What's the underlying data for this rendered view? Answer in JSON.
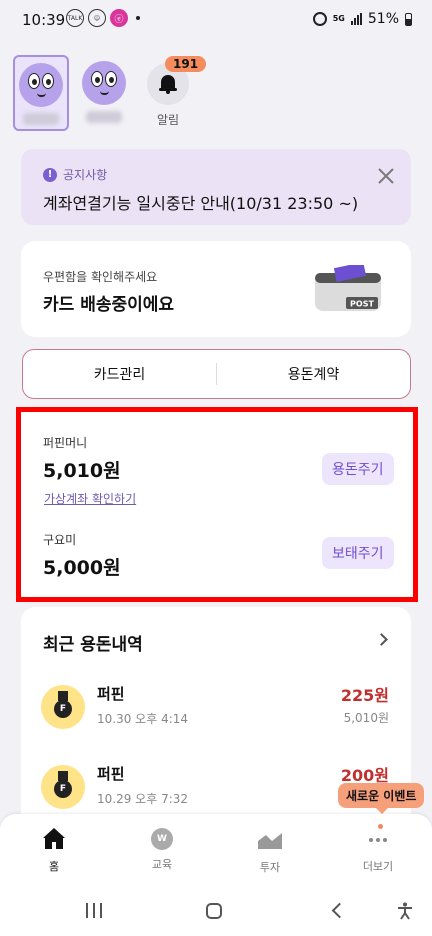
{
  "status_bar": {
    "time": "10:39",
    "app_icon_1": "TALK",
    "app_icon_2": "ⓔ",
    "network": "5G",
    "battery": "51%"
  },
  "profiles": {
    "alarm_badge": "191",
    "alarm_label": "알림"
  },
  "notice": {
    "tag": "공지사항",
    "text": "계좌연결기능 일시중단 안내(10/31 23:50 ~)"
  },
  "delivery": {
    "subtitle": "우편함을 확인해주세요",
    "title": "카드 배송중이에요",
    "mailbox_label": "POST"
  },
  "tabs": {
    "card_manage": "카드관리",
    "allowance_contract": "용돈계약"
  },
  "accounts": {
    "puffin_money_label": "퍼핀머니",
    "puffin_money_value": "5,010원",
    "virtual_account_link": "가상계좌 확인하기",
    "give_allowance_button": "용돈주기",
    "guyomi_label": "구요미",
    "guyomi_value": "5,000원",
    "add_more_button": "보태주기"
  },
  "history": {
    "title": "최근 용돈내역",
    "items": [
      {
        "name": "퍼핀",
        "date": "10.30 오후 4:14",
        "amount": "225원",
        "balance": "5,010원"
      },
      {
        "name": "퍼핀",
        "date": "10.29 오후 7:32",
        "amount": "200원",
        "balance": ""
      }
    ]
  },
  "event_bubble": "새로운 이벤트",
  "bottom_nav": {
    "home": "홈",
    "education": "교육",
    "invest": "투자",
    "more": "더보기"
  },
  "colors": {
    "accent": "#6f4fd0",
    "amount": "#c0302e",
    "highlight": "#ff0000",
    "badge": "#f58c5e"
  }
}
